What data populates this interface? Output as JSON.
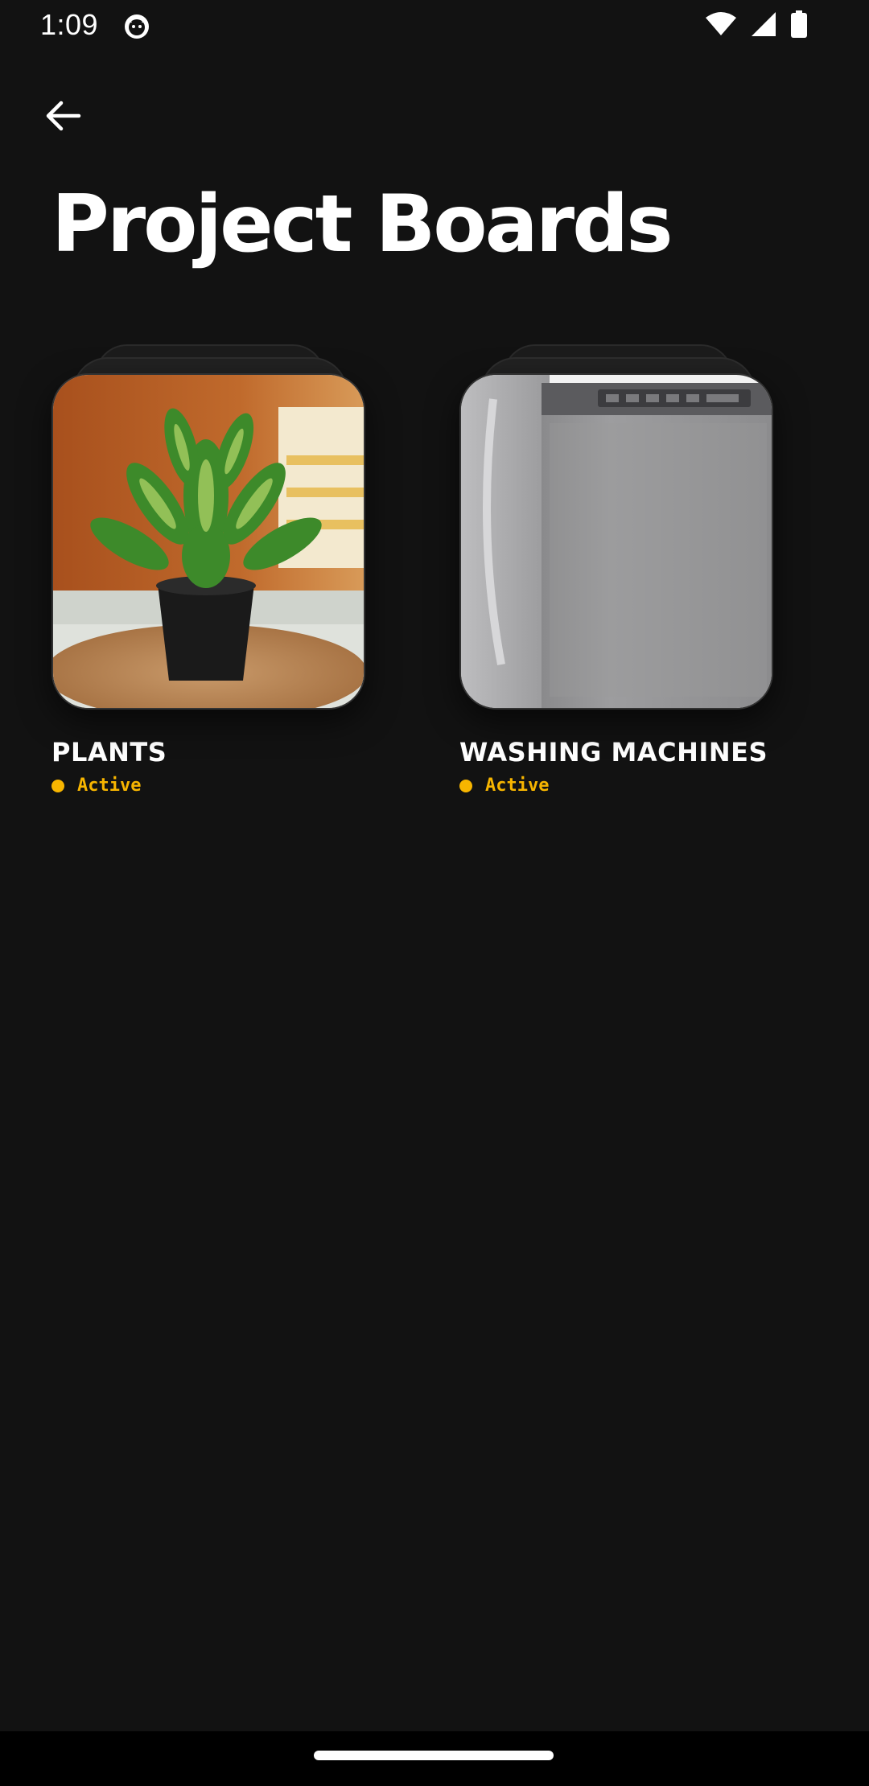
{
  "status_bar": {
    "time": "1:09",
    "icons": [
      "cat-notification-icon",
      "wifi-icon",
      "signal-icon",
      "battery-icon"
    ]
  },
  "header": {
    "back_icon": "arrow-left-icon",
    "title": "Project Boards"
  },
  "boards": [
    {
      "name": "PLANTS",
      "status": "Active",
      "thumbnail": "potted-plant-image"
    },
    {
      "name": "WASHING MACHINES",
      "status": "Active",
      "thumbnail": "washing-machine-image"
    }
  ],
  "colors": {
    "background": "#121212",
    "status_accent": "#f7b500",
    "text": "#ffffff"
  }
}
